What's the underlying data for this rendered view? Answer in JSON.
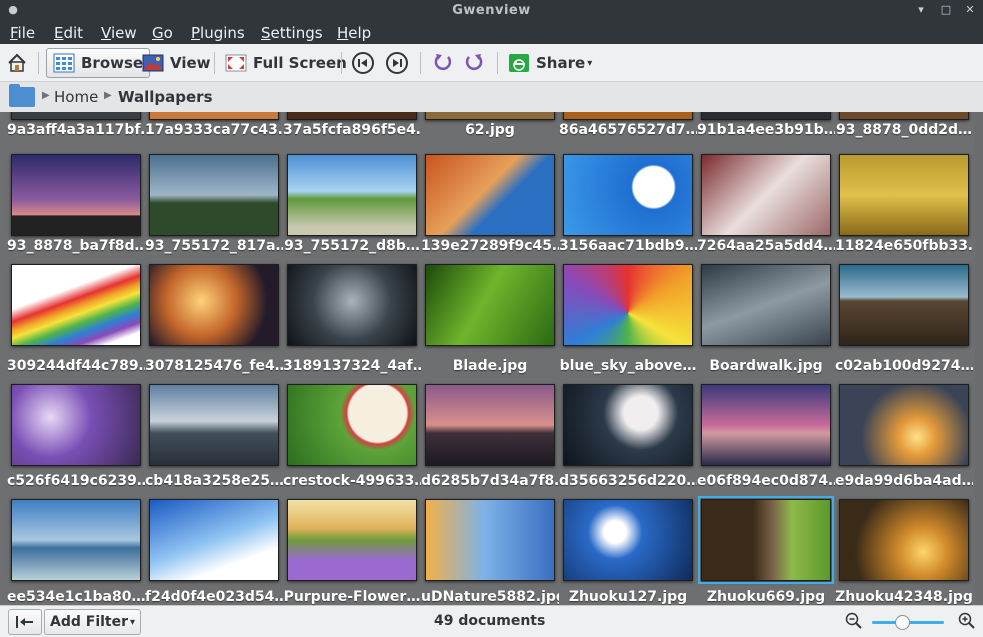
{
  "window": {
    "title": "Gwenview"
  },
  "menubar": {
    "items": [
      "File",
      "Edit",
      "View",
      "Go",
      "Plugins",
      "Settings",
      "Help"
    ]
  },
  "toolbar": {
    "browse_label": "Browse",
    "view_label": "View",
    "fullscreen_label": "Full Screen",
    "share_label": "Share"
  },
  "breadcrumb": {
    "home": "Home",
    "current": "Wallpapers"
  },
  "grid": {
    "partial_row": [
      "9a3aff4a3a117bf…",
      "17a9333ca77c43…",
      "37a5fcfa896f5e4…",
      "62.jpg",
      "86a46576527d7…",
      "91b1a4ee3b91b…",
      "93_8878_0dd2d…"
    ],
    "rows": [
      [
        "93_8878_ba7f8d…",
        "93_755172_817a…",
        "93_755172_d8b…",
        "139e27289f9c45…",
        "3156aac71bdb9…",
        "7264aa25a5dd4…",
        "11824e650fbb33…"
      ],
      [
        "309244df44c789…",
        "3078125476_fe4…",
        "3189137324_4af…",
        "Blade.jpg",
        "blue_sky_above…",
        "Boardwalk.jpg",
        "c02ab100d9274…"
      ],
      [
        "c526f6419c6239…",
        "cb418a3258e25…",
        "crestock-499633…",
        "d6285b7d34a7f8…",
        "d35663256d220…",
        "e06f894ec0d874…",
        "e9da99d6ba4ad…"
      ],
      [
        "ee534e1c1ba80…",
        "f24d0f4e023d54…",
        "Purpure-Flower…",
        "uDNature5882.jpg",
        "Zhuoku127.jpg",
        "Zhuoku669.jpg",
        "Zhuoku42348.jpg"
      ]
    ],
    "selected": "Zhuoku669.jpg"
  },
  "statusbar": {
    "add_filter_label": "Add Filter",
    "document_count": "49 documents"
  },
  "colors": {
    "accent": "#3daee9",
    "grid_bg": "#6e6f70",
    "chrome_dark": "#31363b",
    "chrome_light": "#eff0f1"
  }
}
